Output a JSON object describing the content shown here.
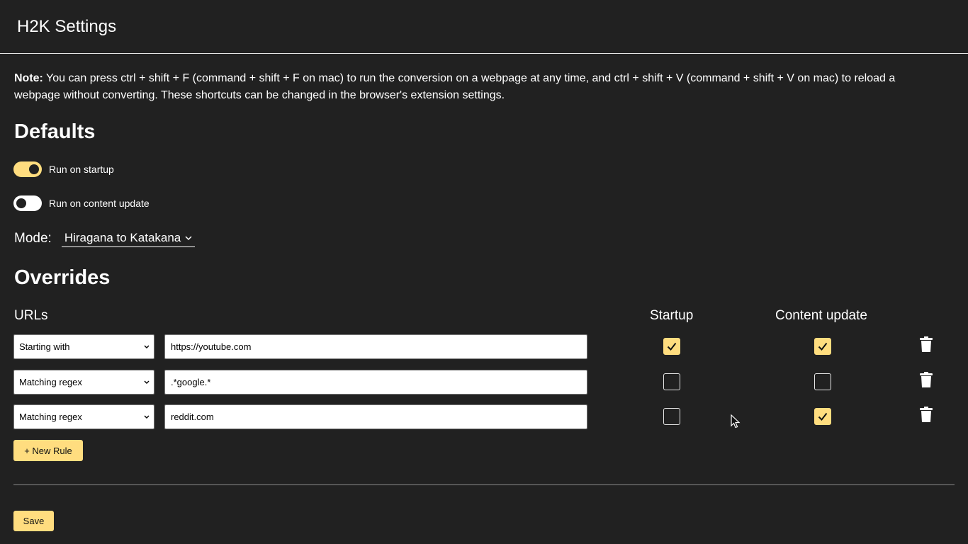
{
  "header": {
    "title": "H2K Settings"
  },
  "note": {
    "label": "Note:",
    "text": " You can press ctrl + shift + F (command + shift + F on mac) to run the conversion on a webpage at any time, and ctrl + shift + V (command + shift + V on mac) to reload a webpage without converting. These shortcuts can be changed in the browser's extension settings."
  },
  "defaults": {
    "heading": "Defaults",
    "run_on_startup": {
      "label": "Run on startup",
      "on": true
    },
    "run_on_content_update": {
      "label": "Run on content update",
      "on": false
    },
    "mode": {
      "label": "Mode:",
      "value": "Hiragana to Katakana"
    }
  },
  "overrides": {
    "heading": "Overrides",
    "columns": {
      "urls": "URLs",
      "startup": "Startup",
      "content_update": "Content update"
    },
    "rules": [
      {
        "match": "Starting with",
        "url": "https://youtube.com",
        "startup": true,
        "content_update": true
      },
      {
        "match": "Matching regex",
        "url": ".*google.*",
        "startup": false,
        "content_update": false
      },
      {
        "match": "Matching regex",
        "url": "reddit.com",
        "startup": false,
        "content_update": true
      }
    ],
    "new_rule_label": "+ New Rule"
  },
  "save_label": "Save",
  "colors": {
    "background": "#212121",
    "accent": "#ffdd7f",
    "text": "#ffffff"
  },
  "icons": {
    "delete": "trash-icon",
    "dropdown": "chevron-down-icon",
    "check": "check-icon"
  }
}
